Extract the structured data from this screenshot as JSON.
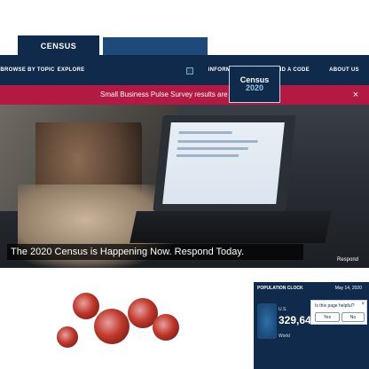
{
  "header": {
    "logo_text": "CENSUS",
    "logo_secondary": ""
  },
  "nav": {
    "items": [
      {
        "label": "BROWSE BY TOPIC"
      },
      {
        "label": "EXPLORE"
      },
      {
        "label": "INFORMATION FOR..."
      },
      {
        "label": "FIND A CODE"
      },
      {
        "label": "ABOUT US"
      }
    ]
  },
  "banner": {
    "text": "Small Business Pulse Survey results are now available.",
    "close_glyph": "×"
  },
  "hero": {
    "card_title": "Census",
    "card_year": "2020",
    "headline": "The 2020 Census is Happening Now. Respond Today.",
    "respond_tag": "Respond"
  },
  "popclock": {
    "title": "POPULATION CLOCK",
    "date": "May 14, 2020",
    "us_label": "U.S.",
    "us_value": "329,64",
    "world_label": "World"
  },
  "feedback": {
    "question": "Is this page helpful?",
    "yes": "Yes",
    "no": "No",
    "close_glyph": "×"
  },
  "colors": {
    "navy": "#0f2a4a",
    "banner_red": "#b31942",
    "virus_red": "#c0392b"
  }
}
